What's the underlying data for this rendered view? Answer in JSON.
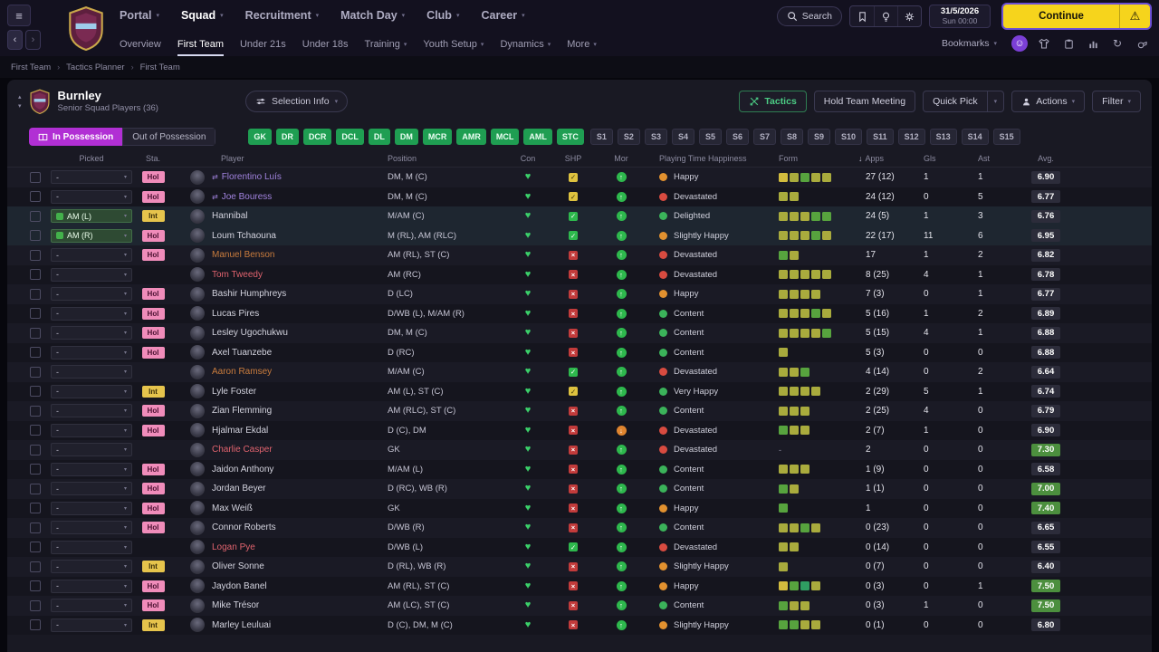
{
  "topbar": {
    "nav": [
      {
        "label": "Portal",
        "caret": true,
        "active": false
      },
      {
        "label": "Squad",
        "caret": true,
        "active": true
      },
      {
        "label": "Recruitment",
        "caret": true,
        "active": false
      },
      {
        "label": "Match Day",
        "caret": true,
        "active": false
      },
      {
        "label": "Club",
        "caret": true,
        "active": false
      },
      {
        "label": "Career",
        "caret": true,
        "active": false
      }
    ],
    "search_label": "Search",
    "date": "31/5/2026",
    "day_time": "Sun 00:00",
    "continue_label": "Continue",
    "bookmarks_label": "Bookmarks"
  },
  "subnav": {
    "items": [
      {
        "label": "Overview",
        "caret": false,
        "active": false
      },
      {
        "label": "First Team",
        "caret": false,
        "active": true
      },
      {
        "label": "Under 21s",
        "caret": false,
        "active": false
      },
      {
        "label": "Under 18s",
        "caret": false,
        "active": false
      },
      {
        "label": "Training",
        "caret": true,
        "active": false
      },
      {
        "label": "Youth Setup",
        "caret": true,
        "active": false
      },
      {
        "label": "Dynamics",
        "caret": true,
        "active": false
      },
      {
        "label": "More",
        "caret": true,
        "active": false
      }
    ]
  },
  "breadcrumb": {
    "items": [
      "First Team",
      "Tactics Planner",
      "First Team"
    ]
  },
  "squad_panel": {
    "club_name": "Burnley",
    "subtitle": "Senior Squad Players (36)",
    "selection_info_label": "Selection Info",
    "tactics_label": "Tactics",
    "meeting_label": "Hold Team Meeting",
    "quick_pick_label": "Quick Pick",
    "actions_label": "Actions",
    "filter_label": "Filter",
    "in_possession_label": "In Possession",
    "out_possession_label": "Out of Possession",
    "position_chips": [
      "GK",
      "DR",
      "DCR",
      "DCL",
      "DL",
      "DM",
      "MCR",
      "AMR",
      "MCL",
      "AML",
      "STC"
    ],
    "slot_chips": [
      "S1",
      "S2",
      "S3",
      "S4",
      "S5",
      "S6",
      "S7",
      "S8",
      "S9",
      "S10",
      "S11",
      "S12",
      "S13",
      "S14",
      "S15"
    ]
  },
  "table": {
    "headers": [
      "Picked",
      "Sta.",
      "Player",
      "Position",
      "Con",
      "SHP",
      "Mor",
      "Playing Time Happiness",
      "Form",
      "Apps",
      "Gls",
      "Ast",
      "Avg."
    ],
    "sorted_by": "Apps",
    "rows": [
      {
        "picked": "-",
        "picked_active": false,
        "status": "Hol",
        "name": "Florentino Luís",
        "name_color": "purple",
        "listed_icon": true,
        "position": "DM, M (C)",
        "sharpness": "yellow",
        "morale": "green",
        "happiness": "Happy",
        "happiness_color": "orange",
        "form": [
          "y",
          "o",
          "g",
          "o",
          "o"
        ],
        "apps": "27 (12)",
        "goals": "1",
        "assists": "1",
        "avg": "6.90",
        "avg_green": false,
        "selected": false
      },
      {
        "picked": "-",
        "picked_active": false,
        "status": "Hol",
        "name": "Joe Bouress",
        "name_color": "purple",
        "listed_icon": true,
        "position": "DM, M (C)",
        "sharpness": "yellow",
        "morale": "green",
        "happiness": "Devastated",
        "happiness_color": "red",
        "form": [
          "o",
          "o"
        ],
        "apps": "24 (12)",
        "goals": "0",
        "assists": "5",
        "avg": "6.77",
        "avg_green": false,
        "selected": false
      },
      {
        "picked": "AM (L)",
        "picked_active": true,
        "status": "Int",
        "name": "Hannibal",
        "name_color": "normal",
        "listed_icon": false,
        "position": "M/AM (C)",
        "sharpness": "green",
        "morale": "green",
        "happiness": "Delighted",
        "happiness_color": "green",
        "form": [
          "o",
          "o",
          "o",
          "g",
          "g"
        ],
        "apps": "24 (5)",
        "goals": "1",
        "assists": "3",
        "avg": "6.76",
        "avg_green": false,
        "selected": true
      },
      {
        "picked": "AM (R)",
        "picked_active": true,
        "status": "Hol",
        "name": "Loum Tchaouna",
        "name_color": "normal",
        "listed_icon": false,
        "position": "M (RL), AM (RLC)",
        "sharpness": "green",
        "morale": "green",
        "happiness": "Slightly Happy",
        "happiness_color": "orange",
        "form": [
          "o",
          "o",
          "o",
          "g",
          "o"
        ],
        "apps": "22 (17)",
        "goals": "11",
        "assists": "6",
        "avg": "6.95",
        "avg_green": false,
        "selected": true
      },
      {
        "picked": "-",
        "picked_active": false,
        "status": "Hol",
        "name": "Manuel Benson",
        "name_color": "orange",
        "listed_icon": false,
        "position": "AM (RL), ST (C)",
        "sharpness": "red",
        "morale": "green",
        "happiness": "Devastated",
        "happiness_color": "red",
        "form": [
          "g",
          "o"
        ],
        "apps": "17",
        "goals": "1",
        "assists": "2",
        "avg": "6.82",
        "avg_green": false,
        "selected": false
      },
      {
        "picked": "-",
        "picked_active": false,
        "status": "",
        "name": "Tom Tweedy",
        "name_color": "red",
        "listed_icon": false,
        "position": "AM (RC)",
        "sharpness": "red",
        "morale": "green",
        "happiness": "Devastated",
        "happiness_color": "red",
        "form": [
          "o",
          "o",
          "o",
          "o",
          "o"
        ],
        "apps": "8 (25)",
        "goals": "4",
        "assists": "1",
        "avg": "6.78",
        "avg_green": false,
        "selected": false
      },
      {
        "picked": "-",
        "picked_active": false,
        "status": "Hol",
        "name": "Bashir Humphreys",
        "name_color": "normal",
        "listed_icon": false,
        "position": "D (LC)",
        "sharpness": "red",
        "morale": "green",
        "happiness": "Happy",
        "happiness_color": "orange",
        "form": [
          "o",
          "o",
          "o",
          "o"
        ],
        "apps": "7 (3)",
        "goals": "0",
        "assists": "1",
        "avg": "6.77",
        "avg_green": false,
        "selected": false
      },
      {
        "picked": "-",
        "picked_active": false,
        "status": "Hol",
        "name": "Lucas Pires",
        "name_color": "normal",
        "listed_icon": false,
        "position": "D/WB (L), M/AM (R)",
        "sharpness": "red",
        "morale": "green",
        "happiness": "Content",
        "happiness_color": "green",
        "form": [
          "o",
          "o",
          "o",
          "g",
          "o"
        ],
        "apps": "5 (16)",
        "goals": "1",
        "assists": "2",
        "avg": "6.89",
        "avg_green": false,
        "selected": false
      },
      {
        "picked": "-",
        "picked_active": false,
        "status": "Hol",
        "name": "Lesley Ugochukwu",
        "name_color": "normal",
        "listed_icon": false,
        "position": "DM, M (C)",
        "sharpness": "red",
        "morale": "green",
        "happiness": "Content",
        "happiness_color": "green",
        "form": [
          "o",
          "o",
          "o",
          "o",
          "g"
        ],
        "apps": "5 (15)",
        "goals": "4",
        "assists": "1",
        "avg": "6.88",
        "avg_green": false,
        "selected": false
      },
      {
        "picked": "-",
        "picked_active": false,
        "status": "Hol",
        "name": "Axel Tuanzebe",
        "name_color": "normal",
        "listed_icon": false,
        "position": "D (RC)",
        "sharpness": "red",
        "morale": "green",
        "happiness": "Content",
        "happiness_color": "green",
        "form": [
          "o"
        ],
        "apps": "5 (3)",
        "goals": "0",
        "assists": "0",
        "avg": "6.88",
        "avg_green": false,
        "selected": false
      },
      {
        "picked": "-",
        "picked_active": false,
        "status": "",
        "name": "Aaron Ramsey",
        "name_color": "orange",
        "listed_icon": false,
        "position": "M/AM (C)",
        "sharpness": "green",
        "morale": "green",
        "happiness": "Devastated",
        "happiness_color": "red",
        "form": [
          "o",
          "o",
          "g"
        ],
        "apps": "4 (14)",
        "goals": "0",
        "assists": "2",
        "avg": "6.64",
        "avg_green": false,
        "selected": false
      },
      {
        "picked": "-",
        "picked_active": false,
        "status": "Int",
        "name": "Lyle Foster",
        "name_color": "normal",
        "listed_icon": false,
        "position": "AM (L), ST (C)",
        "sharpness": "yellow",
        "morale": "green",
        "happiness": "Very Happy",
        "happiness_color": "green",
        "form": [
          "o",
          "o",
          "o",
          "o"
        ],
        "apps": "2 (29)",
        "goals": "5",
        "assists": "1",
        "avg": "6.74",
        "avg_green": false,
        "selected": false
      },
      {
        "picked": "-",
        "picked_active": false,
        "status": "Hol",
        "name": "Zian Flemming",
        "name_color": "normal",
        "listed_icon": false,
        "position": "AM (RLC), ST (C)",
        "sharpness": "red",
        "morale": "green",
        "happiness": "Content",
        "happiness_color": "green",
        "form": [
          "o",
          "o",
          "o"
        ],
        "apps": "2 (25)",
        "goals": "4",
        "assists": "0",
        "avg": "6.79",
        "avg_green": false,
        "selected": false
      },
      {
        "picked": "-",
        "picked_active": false,
        "status": "Hol",
        "name": "Hjalmar Ekdal",
        "name_color": "normal",
        "listed_icon": false,
        "position": "D (C), DM",
        "sharpness": "red",
        "morale": "amber",
        "happiness": "Devastated",
        "happiness_color": "red",
        "form": [
          "g",
          "o",
          "o"
        ],
        "apps": "2 (7)",
        "goals": "1",
        "assists": "0",
        "avg": "6.90",
        "avg_green": false,
        "selected": false
      },
      {
        "picked": "-",
        "picked_active": false,
        "status": "",
        "name": "Charlie Casper",
        "name_color": "red",
        "listed_icon": false,
        "position": "GK",
        "sharpness": "red",
        "morale": "green",
        "happiness": "Devastated",
        "happiness_color": "red",
        "form": [],
        "apps": "2",
        "goals": "0",
        "assists": "0",
        "avg": "7.30",
        "avg_green": true,
        "selected": false
      },
      {
        "picked": "-",
        "picked_active": false,
        "status": "Hol",
        "name": "Jaidon Anthony",
        "name_color": "normal",
        "listed_icon": false,
        "position": "M/AM (L)",
        "sharpness": "red",
        "morale": "green",
        "happiness": "Content",
        "happiness_color": "green",
        "form": [
          "o",
          "o",
          "o"
        ],
        "apps": "1 (9)",
        "goals": "0",
        "assists": "0",
        "avg": "6.58",
        "avg_green": false,
        "selected": false
      },
      {
        "picked": "-",
        "picked_active": false,
        "status": "Hol",
        "name": "Jordan Beyer",
        "name_color": "normal",
        "listed_icon": false,
        "position": "D (RC), WB (R)",
        "sharpness": "red",
        "morale": "green",
        "happiness": "Content",
        "happiness_color": "green",
        "form": [
          "g",
          "o"
        ],
        "apps": "1 (1)",
        "goals": "0",
        "assists": "0",
        "avg": "7.00",
        "avg_green": true,
        "selected": false
      },
      {
        "picked": "-",
        "picked_active": false,
        "status": "Hol",
        "name": "Max Weiß",
        "name_color": "normal",
        "listed_icon": false,
        "position": "GK",
        "sharpness": "red",
        "morale": "green",
        "happiness": "Happy",
        "happiness_color": "orange",
        "form": [
          "g"
        ],
        "apps": "1",
        "goals": "0",
        "assists": "0",
        "avg": "7.40",
        "avg_green": true,
        "selected": false
      },
      {
        "picked": "-",
        "picked_active": false,
        "status": "Hol",
        "name": "Connor Roberts",
        "name_color": "normal",
        "listed_icon": false,
        "position": "D/WB (R)",
        "sharpness": "red",
        "morale": "green",
        "happiness": "Content",
        "happiness_color": "green",
        "form": [
          "o",
          "o",
          "g",
          "o"
        ],
        "apps": "0 (23)",
        "goals": "0",
        "assists": "0",
        "avg": "6.65",
        "avg_green": false,
        "selected": false
      },
      {
        "picked": "-",
        "picked_active": false,
        "status": "",
        "name": "Logan Pye",
        "name_color": "red",
        "listed_icon": false,
        "position": "D/WB (L)",
        "sharpness": "green",
        "morale": "green",
        "happiness": "Devastated",
        "happiness_color": "red",
        "form": [
          "o",
          "o"
        ],
        "apps": "0 (14)",
        "goals": "0",
        "assists": "0",
        "avg": "6.55",
        "avg_green": false,
        "selected": false
      },
      {
        "picked": "-",
        "picked_active": false,
        "status": "Int",
        "name": "Oliver Sonne",
        "name_color": "normal",
        "listed_icon": false,
        "position": "D (RL), WB (R)",
        "sharpness": "red",
        "morale": "green",
        "happiness": "Slightly Happy",
        "happiness_color": "orange",
        "form": [
          "o"
        ],
        "apps": "0 (7)",
        "goals": "0",
        "assists": "0",
        "avg": "6.40",
        "avg_green": false,
        "selected": false
      },
      {
        "picked": "-",
        "picked_active": false,
        "status": "Hol",
        "name": "Jaydon Banel",
        "name_color": "normal",
        "listed_icon": false,
        "position": "AM (RL), ST (C)",
        "sharpness": "red",
        "morale": "green",
        "happiness": "Happy",
        "happiness_color": "orange",
        "form": [
          "y",
          "g",
          "t",
          "o"
        ],
        "apps": "0 (3)",
        "goals": "0",
        "assists": "1",
        "avg": "7.50",
        "avg_green": true,
        "selected": false
      },
      {
        "picked": "-",
        "picked_active": false,
        "status": "Hol",
        "name": "Mike Trésor",
        "name_color": "normal",
        "listed_icon": false,
        "position": "AM (LC), ST (C)",
        "sharpness": "red",
        "morale": "green",
        "happiness": "Content",
        "happiness_color": "green",
        "form": [
          "g",
          "o",
          "o"
        ],
        "apps": "0 (3)",
        "goals": "1",
        "assists": "0",
        "avg": "7.50",
        "avg_green": true,
        "selected": false
      },
      {
        "picked": "-",
        "picked_active": false,
        "status": "Int",
        "name": "Marley Leuluai",
        "name_color": "normal",
        "listed_icon": false,
        "position": "D (C), DM, M (C)",
        "sharpness": "red",
        "morale": "green",
        "happiness": "Slightly Happy",
        "happiness_color": "orange",
        "form": [
          "g",
          "g",
          "o",
          "o"
        ],
        "apps": "0 (1)",
        "goals": "0",
        "assists": "0",
        "avg": "6.80",
        "avg_green": false,
        "selected": false
      }
    ]
  },
  "icons": {
    "hamburger": "≡",
    "back": "‹",
    "forward": "›",
    "caret": "▾",
    "collapse_up": "▴",
    "collapse_down": "▾",
    "warning": "⚠",
    "heart": "♥",
    "check": "✓",
    "cross": "×",
    "up": "↑",
    "down": "↓",
    "swap": "⇄",
    "crumb_sep": "›",
    "sort_desc": "↓",
    "sync": "↻",
    "face": "☺",
    "dash": "-"
  },
  "palette": {
    "css": {
      "accent-yellow": "#f6d41c",
      "possession-purple": "#b12fd4",
      "chip-green": "#1f9e52",
      "badge-green": "#4c8f3e",
      "hol-pink": "#f08cba",
      "int-yellow": "#e6c44c",
      "tactics-green": "#4ccd85",
      "heart-green": "#3bd06a",
      "subnav-underline": "#d7d9f0",
      "selected-row": "#1e2630"
    },
    "name_colors": {
      "normal": "#d3d3de",
      "purple": "#a183de",
      "orange": "#c97c3d",
      "red": "#e0636e"
    },
    "mood_colors": {
      "green": "#3bb35a",
      "orange": "#e2912f",
      "red": "#d84b40"
    },
    "form_colors": {
      "y": "#d2bc3e",
      "o": "#a9ab3d",
      "g": "#57a33e",
      "t": "#2f9e62"
    },
    "sharpness_colors": {
      "green": "#2eb84d",
      "yellow": "#dec23f",
      "red": "#c23b3b"
    },
    "morale_colors": {
      "green": "#2eb84d",
      "amber": "#e0852f"
    }
  }
}
